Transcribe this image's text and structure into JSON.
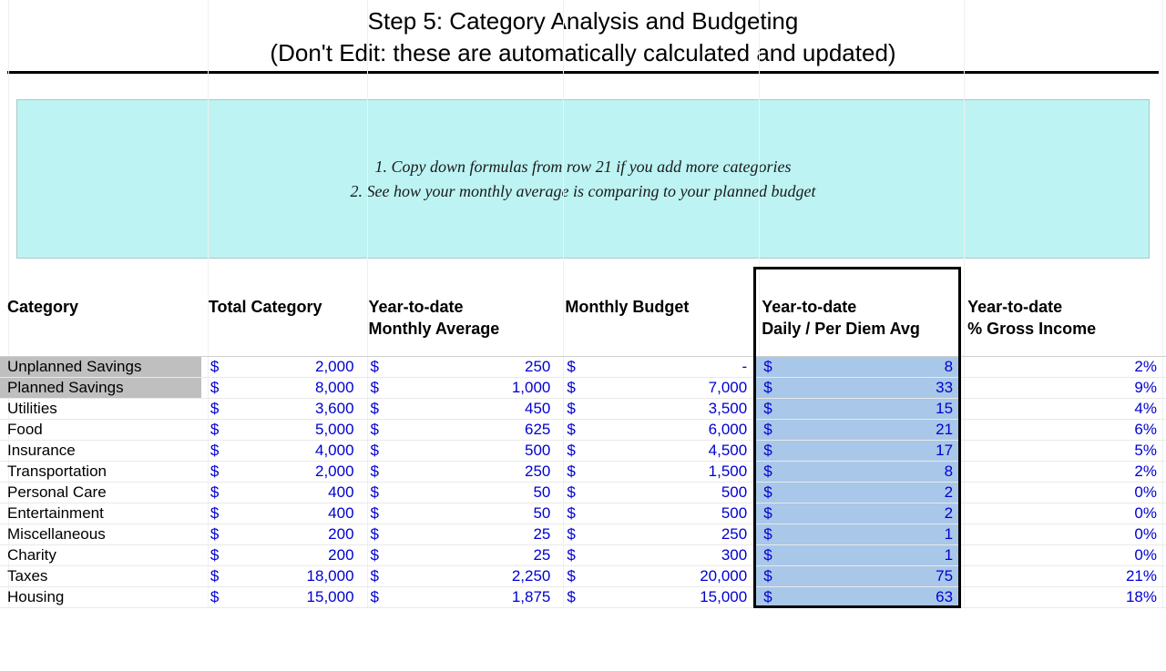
{
  "title": {
    "line1": "Step 5: Category Analysis and Budgeting",
    "line2": "(Don't Edit: these are automatically calculated and updated)"
  },
  "notes": {
    "line1": "1. Copy down formulas from row 21 if you add more categories",
    "line2": "2. See how your monthly average is comparing to your planned budget"
  },
  "headers": {
    "category": "Category",
    "total": "Total Category",
    "monthly_avg_l1": "Year-to-date",
    "monthly_avg_l2": "Monthly Average",
    "monthly_budget": "Monthly Budget",
    "daily_l1": "Year-to-date",
    "daily_l2": "Daily / Per Diem Avg",
    "pct_l1": "Year-to-date",
    "pct_l2": "% Gross Income"
  },
  "currency_symbol": "$",
  "rows": [
    {
      "cat": "Unplanned Savings",
      "shade": true,
      "total": "2,000",
      "mavg": "250",
      "mbud": "-",
      "daily": "8",
      "pct": "2%"
    },
    {
      "cat": "Planned Savings",
      "shade": true,
      "total": "8,000",
      "mavg": "1,000",
      "mbud": "7,000",
      "daily": "33",
      "pct": "9%"
    },
    {
      "cat": "Utilities",
      "shade": false,
      "total": "3,600",
      "mavg": "450",
      "mbud": "3,500",
      "daily": "15",
      "pct": "4%"
    },
    {
      "cat": "Food",
      "shade": false,
      "total": "5,000",
      "mavg": "625",
      "mbud": "6,000",
      "daily": "21",
      "pct": "6%"
    },
    {
      "cat": "Insurance",
      "shade": false,
      "total": "4,000",
      "mavg": "500",
      "mbud": "4,500",
      "daily": "17",
      "pct": "5%"
    },
    {
      "cat": "Transportation",
      "shade": false,
      "total": "2,000",
      "mavg": "250",
      "mbud": "1,500",
      "daily": "8",
      "pct": "2%"
    },
    {
      "cat": "Personal Care",
      "shade": false,
      "total": "400",
      "mavg": "50",
      "mbud": "500",
      "daily": "2",
      "pct": "0%"
    },
    {
      "cat": "Entertainment",
      "shade": false,
      "total": "400",
      "mavg": "50",
      "mbud": "500",
      "daily": "2",
      "pct": "0%"
    },
    {
      "cat": "Miscellaneous",
      "shade": false,
      "total": "200",
      "mavg": "25",
      "mbud": "250",
      "daily": "1",
      "pct": "0%"
    },
    {
      "cat": "Charity",
      "shade": false,
      "total": "200",
      "mavg": "25",
      "mbud": "300",
      "daily": "1",
      "pct": "0%"
    },
    {
      "cat": "Taxes",
      "shade": false,
      "total": "18,000",
      "mavg": "2,250",
      "mbud": "20,000",
      "daily": "75",
      "pct": "21%"
    },
    {
      "cat": "Housing",
      "shade": false,
      "total": "15,000",
      "mavg": "1,875",
      "mbud": "15,000",
      "daily": "63",
      "pct": "18%"
    }
  ],
  "chart_data": {
    "type": "table",
    "title": "Step 5: Category Analysis and Budgeting",
    "columns": [
      "Category",
      "Total Category",
      "Year-to-date Monthly Average",
      "Monthly Budget",
      "Year-to-date Daily / Per Diem Avg",
      "Year-to-date % Gross Income"
    ],
    "rows": [
      [
        "Unplanned Savings",
        2000,
        250,
        0,
        8,
        0.02
      ],
      [
        "Planned Savings",
        8000,
        1000,
        7000,
        33,
        0.09
      ],
      [
        "Utilities",
        3600,
        450,
        3500,
        15,
        0.04
      ],
      [
        "Food",
        5000,
        625,
        6000,
        21,
        0.06
      ],
      [
        "Insurance",
        4000,
        500,
        4500,
        17,
        0.05
      ],
      [
        "Transportation",
        2000,
        250,
        1500,
        8,
        0.02
      ],
      [
        "Personal Care",
        400,
        50,
        500,
        2,
        0.0
      ],
      [
        "Entertainment",
        400,
        50,
        500,
        2,
        0.0
      ],
      [
        "Miscellaneous",
        200,
        25,
        250,
        1,
        0.0
      ],
      [
        "Charity",
        200,
        25,
        300,
        1,
        0.0
      ],
      [
        "Taxes",
        18000,
        2250,
        20000,
        75,
        0.21
      ],
      [
        "Housing",
        15000,
        1875,
        15000,
        63,
        0.18
      ]
    ]
  }
}
